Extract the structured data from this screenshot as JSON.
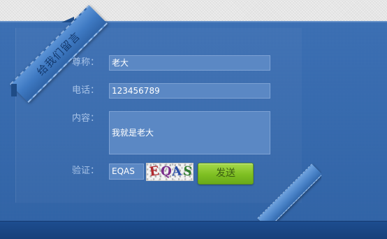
{
  "ribbon": {
    "text": "给我们留言"
  },
  "form": {
    "nickname": {
      "label": "尊称：",
      "value": "老大"
    },
    "phone": {
      "label": "电话：",
      "value": "123456789"
    },
    "content": {
      "label": "内容：",
      "value": "我就是老大"
    },
    "captcha": {
      "label": "验证：",
      "value": "EQAS",
      "image_chars": [
        "E",
        "Q",
        "A",
        "S"
      ],
      "image_colors": [
        "#b0272d",
        "#7a2d8c",
        "#2a4fa8",
        "#2f7d2f"
      ]
    },
    "submit_label": "发送"
  },
  "colors": {
    "panel": "#3468ad",
    "field": "#5b88c4",
    "label": "#a9c4e8",
    "button": "#7ebf22",
    "footer": "#17407a"
  }
}
